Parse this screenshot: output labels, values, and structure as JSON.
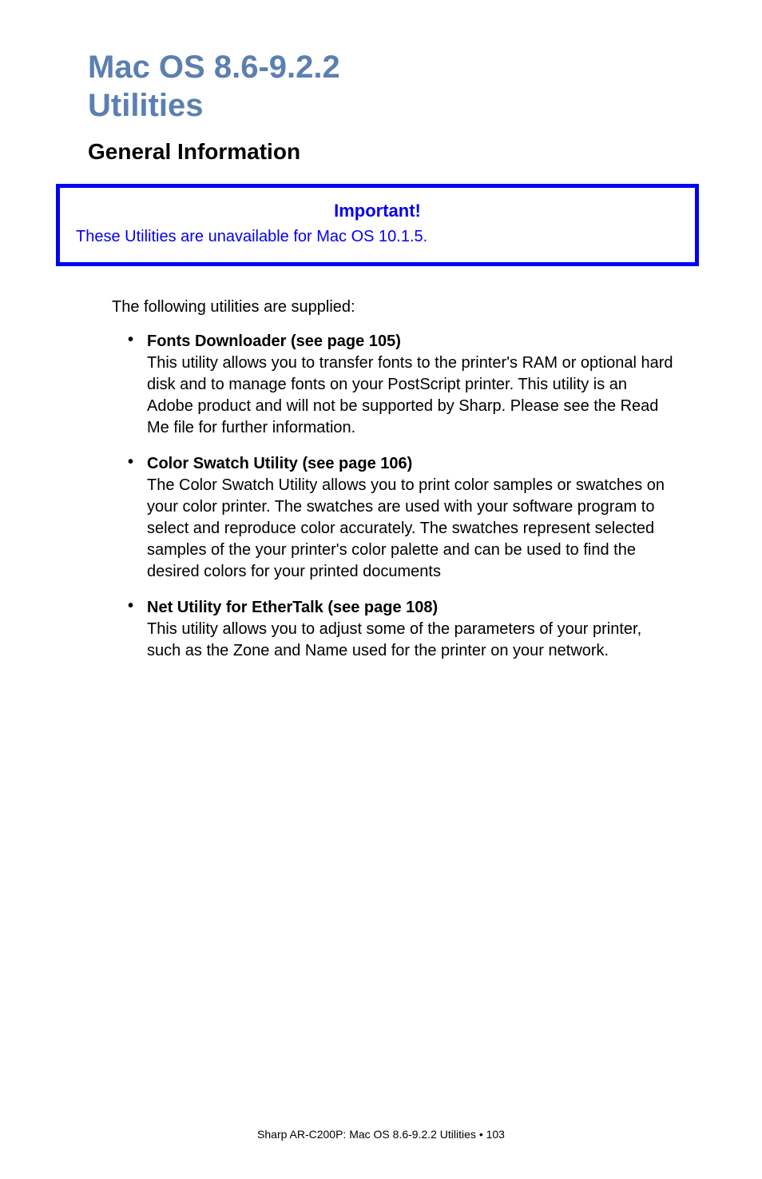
{
  "title": {
    "line1": "Mac OS 8.6-9.2.2",
    "line2": "Utilities"
  },
  "section_heading": "General Information",
  "callout": {
    "heading": "Important!",
    "text": "These Utilities are unavailable for Mac OS 10.1.5."
  },
  "intro": "The following utilities are supplied:",
  "bullets": [
    {
      "title": "Fonts Downloader (see page 105)",
      "body": "This utility allows you to transfer fonts to the printer's RAM or optional hard disk and to manage fonts on your PostScript printer. This utility is an Adobe product and will not be supported by Sharp. Please see the Read Me file for further information."
    },
    {
      "title": "Color Swatch Utility (see page 106)",
      "body": "The Color Swatch Utility allows you to print color samples or swatches on your color printer. The swatches are used with your software program to select and reproduce color accurately. The swatches represent selected samples of the your printer's color palette and can be used to find the desired colors for your printed documents"
    },
    {
      "title": "Net Utility for EtherTalk (see page 108)",
      "body": "This utility allows you to adjust some of the parameters of your printer, such as the Zone and Name used for the printer on your network."
    }
  ],
  "footer": "Sharp AR-C200P: Mac OS 8.6-9.2.2 Utilities   •   103"
}
